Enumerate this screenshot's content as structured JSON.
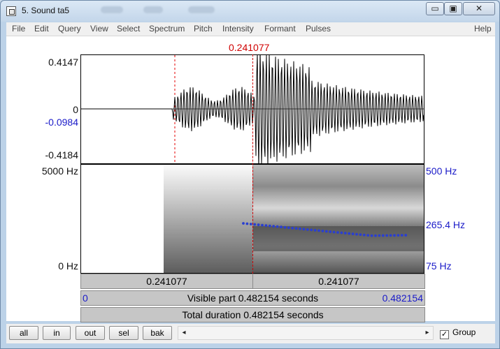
{
  "window": {
    "title": "5. Sound ta5",
    "controls": {
      "minimize": "▭",
      "maximize": "▣",
      "close": "✕"
    }
  },
  "menu": [
    "File",
    "Edit",
    "Query",
    "View",
    "Select",
    "Spectrum",
    "Pitch",
    "Intensity",
    "Formant",
    "Pulses"
  ],
  "help": "Help",
  "cursor": {
    "time_label": "0.241077",
    "cursor_color": "#d00000"
  },
  "waveform": {
    "max_label": "0.4147",
    "zero_label": "0",
    "cursor_value_label": "-0.0984",
    "min_label": "-0.4184"
  },
  "spectrogram": {
    "top_label": "5000 Hz",
    "bottom_label": "0 Hz",
    "pitch_top_label": "500 Hz",
    "pitch_current_label": "265.4 Hz",
    "pitch_bottom_label": "75 Hz",
    "pitch_color": "#2a3fd0"
  },
  "time_rows": {
    "left_segment": "0.241077",
    "right_segment": "0.241077",
    "visible_start": "0",
    "visible_text": "Visible part 0.482154 seconds",
    "visible_end": "0.482154",
    "total_text": "Total duration 0.482154 seconds"
  },
  "bottom": {
    "buttons": [
      "all",
      "in",
      "out",
      "sel",
      "bak"
    ],
    "scroll_left": "◂",
    "scroll_right": "▸",
    "group_checked": "✓",
    "group_label": "Group"
  }
}
